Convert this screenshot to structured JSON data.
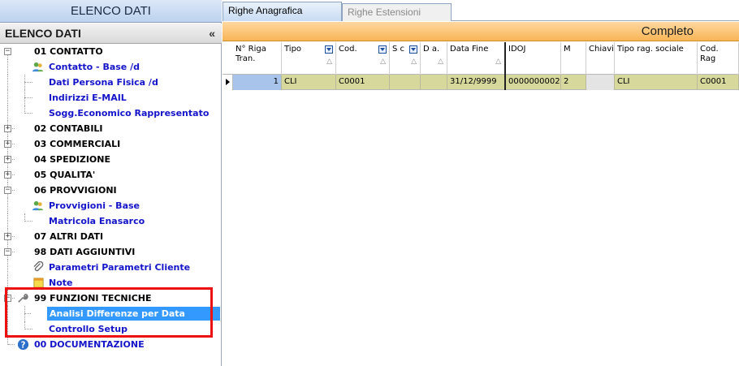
{
  "window": {
    "title": "ELENCO DATI"
  },
  "sidebar": {
    "header": "ELENCO DATI",
    "collapse_label": "«",
    "groups": [
      {
        "label": "01 CONTATTO",
        "expander": "−",
        "children": [
          {
            "label": "Contatto - Base /d",
            "icon": "users-icon"
          },
          {
            "label": "Dati Persona Fisica /d"
          },
          {
            "label": "Indirizzi E-MAIL"
          },
          {
            "label": "Sogg.Economico Rappresentato"
          }
        ]
      },
      {
        "label": "02 CONTABILI",
        "expander": "+"
      },
      {
        "label": "03 COMMERCIALI",
        "expander": "+"
      },
      {
        "label": "04 SPEDIZIONE",
        "expander": "+"
      },
      {
        "label": "05 QUALITA'",
        "expander": "+"
      },
      {
        "label": "06 PROVVIGIONI",
        "expander": "−",
        "children": [
          {
            "label": "Provvigioni - Base",
            "icon": "users-icon"
          },
          {
            "label": "Matricola Enasarco"
          }
        ]
      },
      {
        "label": "07 ALTRI DATI",
        "expander": "+"
      },
      {
        "label": "98 DATI AGGIUNTIVI",
        "expander": "−",
        "children": [
          {
            "label": "Parametri Parametri Cliente",
            "icon": "paperclip-icon"
          },
          {
            "label": "Note",
            "icon": "note-icon"
          }
        ]
      },
      {
        "label": "99 FUNZIONI TECNICHE",
        "expander": "−",
        "icon": "wrench-icon",
        "children": [
          {
            "label": "Analisi Differenze per Data",
            "selected": true
          },
          {
            "label": "Controllo Setup"
          }
        ]
      },
      {
        "label": "00 DOCUMENTAZIONE",
        "icon": "help-icon"
      }
    ]
  },
  "tabs": [
    {
      "label": "Righe Anagrafica",
      "active": true
    },
    {
      "label": "Righe Estensioni",
      "active": false
    }
  ],
  "banner": "Completo",
  "grid": {
    "columns": [
      {
        "label": "N° Riga Tran."
      },
      {
        "label": "Tipo"
      },
      {
        "label": "Cod."
      },
      {
        "label": "S c"
      },
      {
        "label": "D a."
      },
      {
        "label": "Data Fine"
      },
      {
        "label": "IDOJ"
      },
      {
        "label": "M"
      },
      {
        "label": "Chiavi"
      },
      {
        "label": "Tipo rag. sociale"
      },
      {
        "label": "Cod. Rag"
      }
    ],
    "rows": [
      [
        "1",
        "CLI",
        "C0001",
        "",
        "",
        "31/12/9999",
        "0000000002",
        "2",
        "",
        "CLI",
        "C0001"
      ]
    ]
  },
  "colors": {
    "accent": "#3399ff",
    "banner": "#f8b555",
    "row_bg": "#d6d89c",
    "highlight": "#ee1111",
    "link": "#1414c8"
  }
}
